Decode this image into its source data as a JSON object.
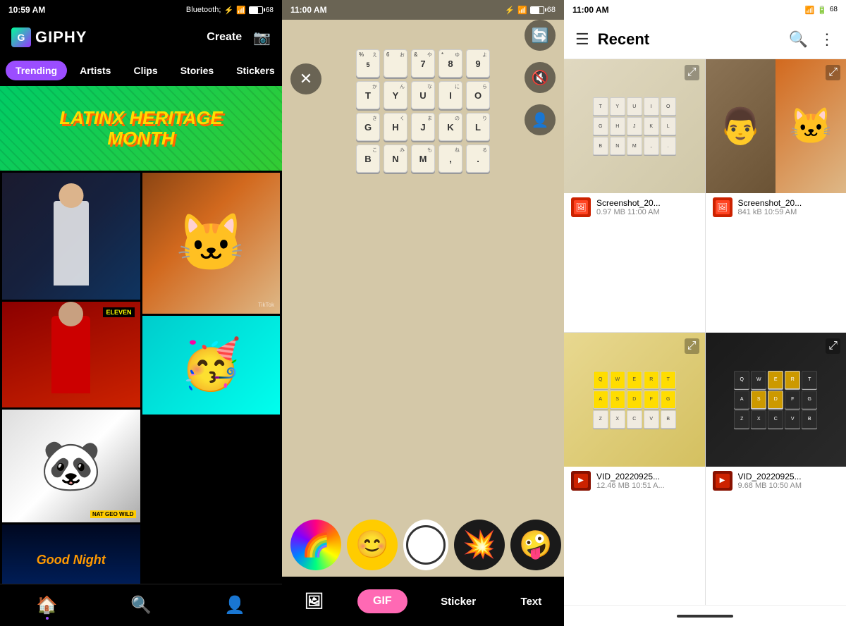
{
  "panel_giphy": {
    "status_time": "10:59 AM",
    "logo": "GIPHY",
    "header": {
      "create_label": "Create",
      "camera_icon": "📷"
    },
    "nav_tabs": [
      {
        "label": "Trending",
        "active": true
      },
      {
        "label": "Artists",
        "active": false
      },
      {
        "label": "Clips",
        "active": false
      },
      {
        "label": "Stories",
        "active": false
      },
      {
        "label": "Stickers",
        "active": false
      }
    ],
    "banner_text": "LATINX HERITAGE\nMONTH",
    "bottom_nav": [
      {
        "icon": "🏠",
        "label": "home",
        "active": true
      },
      {
        "icon": "🔍",
        "label": "search",
        "active": false
      },
      {
        "icon": "👤",
        "label": "profile",
        "active": false
      }
    ]
  },
  "panel_camera": {
    "status_time": "11:00 AM",
    "close_icon": "✕",
    "controls": {
      "flip_icon": "🔄",
      "mute_icon": "🔇",
      "face_icon": "👤"
    },
    "stickers": [
      {
        "type": "rainbow",
        "emoji": "🌈"
      },
      {
        "type": "smiley",
        "emoji": "😊"
      },
      {
        "type": "shutter",
        "emoji": ""
      },
      {
        "type": "explosion",
        "emoji": "💥"
      },
      {
        "type": "crazy",
        "emoji": "🤪"
      }
    ],
    "bottom_tabs": [
      {
        "label": "Gallery",
        "type": "icon"
      },
      {
        "label": "GIF",
        "type": "active"
      },
      {
        "label": "Sticker",
        "type": "normal"
      },
      {
        "label": "Text",
        "type": "normal"
      }
    ]
  },
  "panel_files": {
    "status_time": "11:00 AM",
    "title": "Recent",
    "files": [
      {
        "name": "Screenshot_20...",
        "size": "0.97 MB",
        "time": "11:00 AM",
        "type": "image",
        "thumb": "keyboard"
      },
      {
        "name": "Screenshot_20...",
        "size": "841 kB",
        "time": "10:59 AM",
        "type": "image",
        "thumb": "person_cat"
      },
      {
        "name": "VID_20220925...",
        "size": "12.46 MB",
        "time": "10:51 A...",
        "type": "video",
        "thumb": "keyboard_yellow"
      },
      {
        "name": "VID_20220925...",
        "size": "9.68 MB",
        "time": "10:50 AM",
        "type": "video",
        "thumb": "keyboard_dark"
      }
    ]
  }
}
